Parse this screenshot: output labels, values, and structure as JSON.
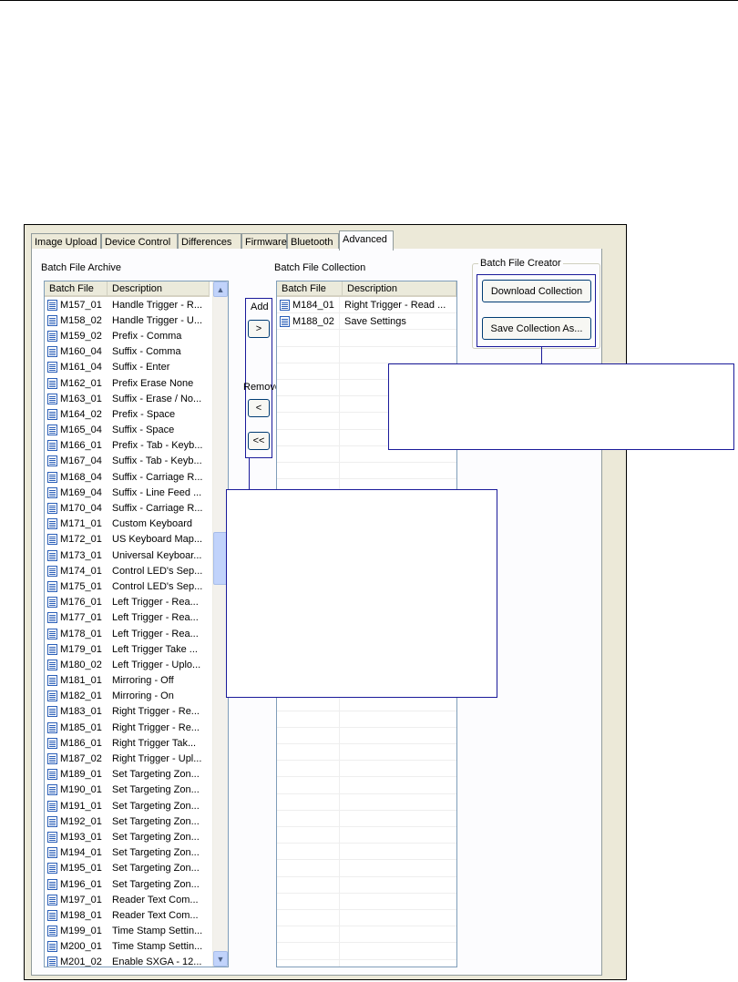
{
  "tabs": [
    {
      "label": "Image Upload",
      "active": false
    },
    {
      "label": "Device Control",
      "active": false
    },
    {
      "label": "Differences",
      "active": false
    },
    {
      "label": "Firmware",
      "active": false
    },
    {
      "label": "Bluetooth",
      "active": false
    },
    {
      "label": "Advanced",
      "active": true
    }
  ],
  "archive": {
    "title": "Batch File Archive",
    "columns": [
      "Batch File",
      "Description"
    ],
    "rows": [
      {
        "file": "M157_01",
        "desc": "Handle Trigger - R..."
      },
      {
        "file": "M158_02",
        "desc": "Handle Trigger - U..."
      },
      {
        "file": "M159_02",
        "desc": "Prefix - Comma"
      },
      {
        "file": "M160_04",
        "desc": "Suffix - Comma"
      },
      {
        "file": "M161_04",
        "desc": "Suffix - Enter"
      },
      {
        "file": "M162_01",
        "desc": "Prefix Erase None"
      },
      {
        "file": "M163_01",
        "desc": "Suffix - Erase / No..."
      },
      {
        "file": "M164_02",
        "desc": "Prefix - Space"
      },
      {
        "file": "M165_04",
        "desc": "Suffix - Space"
      },
      {
        "file": "M166_01",
        "desc": "Prefix - Tab - Keyb..."
      },
      {
        "file": "M167_04",
        "desc": "Suffix - Tab - Keyb..."
      },
      {
        "file": "M168_04",
        "desc": "Suffix - Carriage R..."
      },
      {
        "file": "M169_04",
        "desc": "Suffix - Line Feed ..."
      },
      {
        "file": "M170_04",
        "desc": "Suffix - Carriage R..."
      },
      {
        "file": "M171_01",
        "desc": "Custom Keyboard"
      },
      {
        "file": "M172_01",
        "desc": "US Keyboard Map..."
      },
      {
        "file": "M173_01",
        "desc": "Universal Keyboar..."
      },
      {
        "file": "M174_01",
        "desc": "Control LED's Sep..."
      },
      {
        "file": "M175_01",
        "desc": "Control LED's Sep..."
      },
      {
        "file": "M176_01",
        "desc": "Left Trigger - Rea..."
      },
      {
        "file": "M177_01",
        "desc": "Left Trigger - Rea..."
      },
      {
        "file": "M178_01",
        "desc": "Left Trigger - Rea..."
      },
      {
        "file": "M179_01",
        "desc": "Left Trigger Take ..."
      },
      {
        "file": "M180_02",
        "desc": "Left Trigger - Uplo..."
      },
      {
        "file": "M181_01",
        "desc": "Mirroring - Off"
      },
      {
        "file": "M182_01",
        "desc": "Mirroring - On"
      },
      {
        "file": "M183_01",
        "desc": "Right Trigger - Re..."
      },
      {
        "file": "M185_01",
        "desc": "Right Trigger - Re..."
      },
      {
        "file": "M186_01",
        "desc": "Right Trigger Tak..."
      },
      {
        "file": "M187_02",
        "desc": "Right Trigger - Upl..."
      },
      {
        "file": "M189_01",
        "desc": "Set Targeting Zon..."
      },
      {
        "file": "M190_01",
        "desc": "Set Targeting Zon..."
      },
      {
        "file": "M191_01",
        "desc": "Set Targeting Zon..."
      },
      {
        "file": "M192_01",
        "desc": "Set Targeting Zon..."
      },
      {
        "file": "M193_01",
        "desc": "Set Targeting Zon..."
      },
      {
        "file": "M194_01",
        "desc": "Set Targeting Zon..."
      },
      {
        "file": "M195_01",
        "desc": "Set Targeting Zon..."
      },
      {
        "file": "M196_01",
        "desc": "Set Targeting Zon..."
      },
      {
        "file": "M197_01",
        "desc": "Reader Text Com..."
      },
      {
        "file": "M198_01",
        "desc": "Reader Text Com..."
      },
      {
        "file": "M199_01",
        "desc": "Time Stamp Settin..."
      },
      {
        "file": "M200_01",
        "desc": "Time Stamp Settin..."
      },
      {
        "file": "M201_02",
        "desc": "Enable SXGA - 12..."
      }
    ]
  },
  "collection": {
    "title": "Batch File Collection",
    "columns": [
      "Batch File",
      "Description"
    ],
    "rows": [
      {
        "file": "M184_01",
        "desc": "Right Trigger - Read ..."
      },
      {
        "file": "M188_02",
        "desc": "Save Settings"
      }
    ]
  },
  "transfer": {
    "add_label": "Add",
    "add_button": ">",
    "remove_label": "Remove",
    "remove_button": "<",
    "remove_all_button": "<<"
  },
  "creator": {
    "title": "Batch File Creator",
    "download_button": "Download Collection",
    "save_button": "Save Collection As..."
  },
  "icons": {
    "scroll_up": "scroll-up-arrow-icon",
    "scroll_down": "scroll-down-arrow-icon",
    "file": "batch-file-icon"
  },
  "colors": {
    "callout_border": "#1a1a9a",
    "window_bg": "#ece9d8",
    "button_border": "#003c74"
  }
}
